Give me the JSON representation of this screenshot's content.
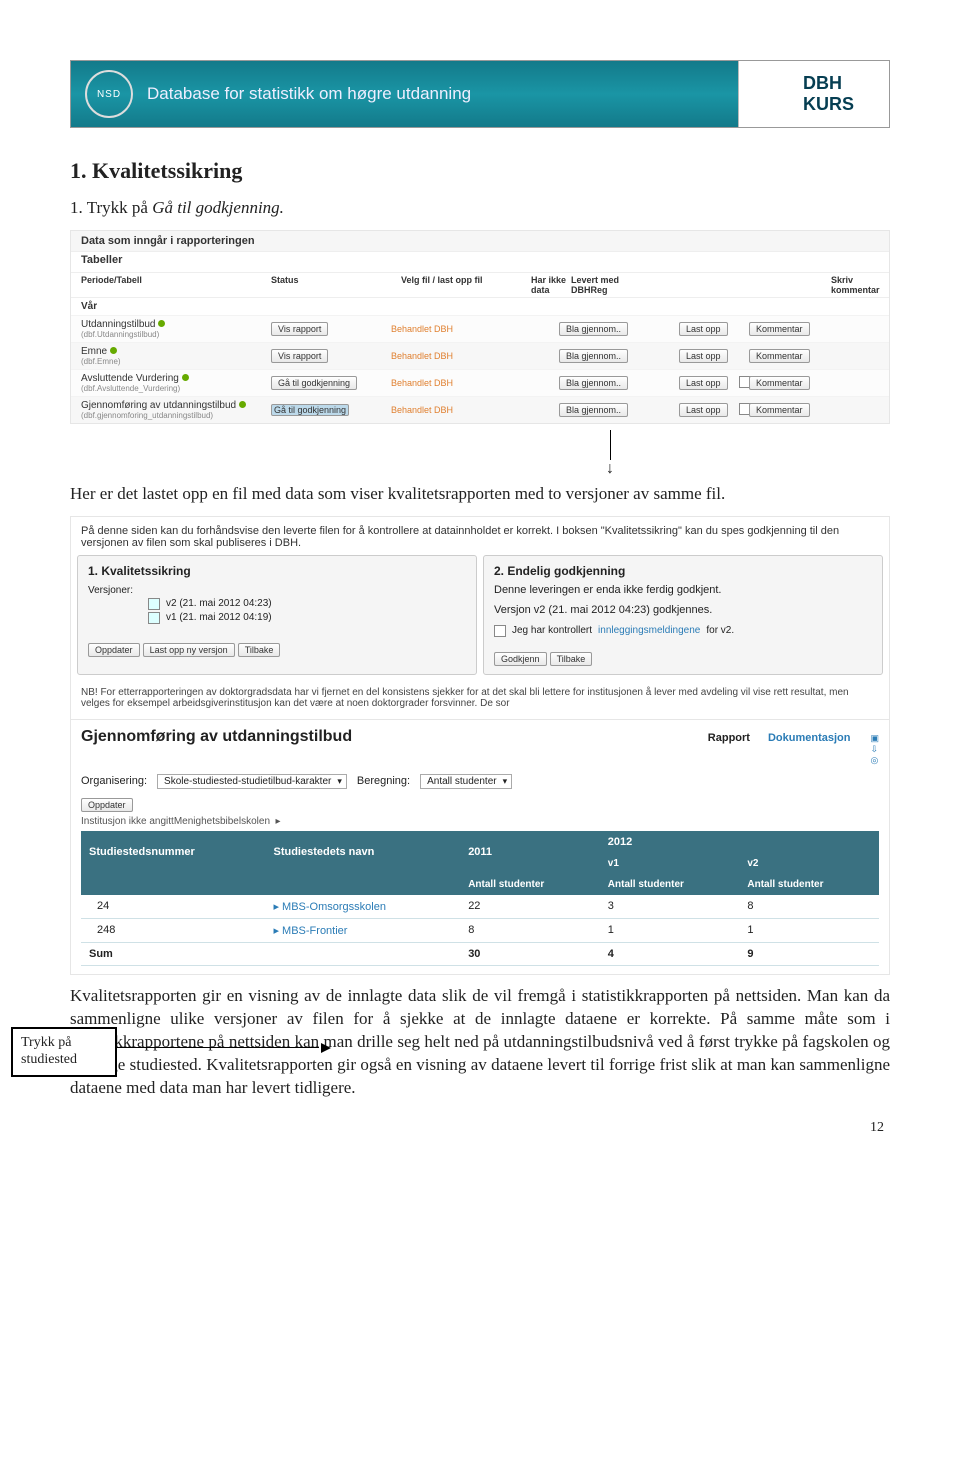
{
  "banner": {
    "title": "Database for statistikk om høgre utdanning",
    "right_top": "DBH",
    "right_bottom": "KURS"
  },
  "section": {
    "heading": "1. Kvalitetssikring",
    "step1": "1. Trykk på ",
    "step1_link": "Gå til godkjenning.",
    "intro2": "Her er det lastet opp en fil med data som viser kvalitetsrapporten med to versjoner av samme fil."
  },
  "shot1": {
    "title": "Data som inngår i rapporteringen",
    "subtitle": "Tabeller",
    "cols": {
      "c1": "Periode/Tabell",
      "c2": "Status",
      "c3": "Velg fil / last opp fil",
      "c4": "Har ikke data",
      "c5": "Levert med DBHReg",
      "c6": "Skriv kommentar"
    },
    "vaar": "Vår",
    "rows": [
      {
        "name": "Utdanningstilbud",
        "sub": "(dbf.Utdanningstilbud)",
        "btn": "Vis rapport",
        "status": "Behandlet DBH",
        "c4": "",
        "c5": "",
        "komm": "Kommentar",
        "bla": "Bla gjennom..",
        "last": "Last opp"
      },
      {
        "name": "Emne",
        "sub": "(dbf.Emne)",
        "btn": "Vis rapport",
        "status": "Behandlet DBH",
        "c4": "",
        "c5": "",
        "komm": "Kommentar",
        "bla": "Bla gjennom..",
        "last": "Last opp"
      },
      {
        "name": "Avsluttende Vurdering",
        "sub": "(dbf.Avsluttende_Vurdering)",
        "btn": "Gå til godkjenning",
        "status": "Behandlet DBH",
        "c4": "cb",
        "c5": "",
        "komm": "Kommentar",
        "bla": "Bla gjennom..",
        "last": "Last opp"
      },
      {
        "name": "Gjennomføring av utdanningstilbud",
        "sub": "(dbf.gjennomforing_utdanningstilbud)",
        "btn": "Gå til godkjenning",
        "status": "Behandlet DBH",
        "c4": "cb",
        "c5": "",
        "komm": "Kommentar",
        "bla": "Bla gjennom..",
        "last": "Last opp",
        "highlight": true
      }
    ]
  },
  "panel": {
    "intro": "På denne siden kan du forhåndsvise den leverte filen for å kontrollere at datainnholdet er korrekt. I boksen \"Kvalitetssikring\" kan du spes godkjenning til den versjonen av filen som skal publiseres i DBH.",
    "left": {
      "title": "1. Kvalitetssikring",
      "verlabel": "Versjoner:",
      "v2": "v2 (21. mai 2012 04:23)",
      "v1": "v1 (21. mai 2012 04:19)",
      "b1": "Oppdater",
      "b2": "Last opp ny versjon",
      "b3": "Tilbake"
    },
    "right": {
      "title": "2. Endelig godkjenning",
      "l1": "Denne leveringen er enda ikke ferdig godkjent.",
      "l2": "Versjon v2 (21. mai 2012 04:23) godkjennes.",
      "chk": "Jeg har kontrollert",
      "chklink": "innleggingsmeldingene",
      "chktail": "for v2.",
      "b1": "Godkjenn",
      "b2": "Tilbake"
    },
    "nb": "NB! For etterrapporteringen av doktorgradsdata har vi fjernet en del konsistens sjekker for at det skal bli lettere for institusjonen å lever med avdeling vil vise rett resultat, men velges for eksempel arbeidsgiverinstitusjon kan det være at noen doktorgrader forsvinner. De sor",
    "sp_title": "Gjennomføring av utdanningstilbud",
    "tab1": "Rapport",
    "tab2": "Dokumentasjon",
    "ctrl": {
      "org": "Organisering:",
      "org_v": "Skole-studiested-studietilbud-karakter",
      "ber": "Beregning:",
      "ber_v": "Antall studenter",
      "opp": "Oppdater"
    },
    "crumb1": "Institusjon ikke angitt",
    "crumb2": "Menighetsbibelskolen",
    "th": {
      "c1": "Studiestedsnummer",
      "c2": "Studiestedets navn",
      "c3": "2011",
      "c4": "2012",
      "c4a": "v1",
      "c4b": "v2",
      "sub": "Antall studenter"
    },
    "rows": [
      {
        "n": "24",
        "name": "MBS-Omsorgsskolen",
        "a": "22",
        "b": "3",
        "c": "8"
      },
      {
        "n": "248",
        "name": "MBS-Frontier",
        "a": "8",
        "b": "1",
        "c": "1"
      }
    ],
    "sum": {
      "label": "Sum",
      "a": "30",
      "b": "4",
      "c": "9"
    }
  },
  "callout": "Trykk på studiested",
  "para": "Kvalitetsrapporten gir en visning av de innlagte data slik de vil fremgå i statistikkrapporten på nettsiden. Man kan da sammenligne ulike versjoner av filen for å sjekke at de innlagte dataene er korrekte. På samme måte som i statistikkrapportene på nettsiden kan man drille seg helt ned på utdanningstilbudsnivå ved å først trykke på fagskolen og så velge studiested. Kvalitetsrapporten gir også en visning av dataene levert til forrige frist slik at man kan sammenligne dataene med data man har levert tidligere.",
  "pagenum": "12"
}
